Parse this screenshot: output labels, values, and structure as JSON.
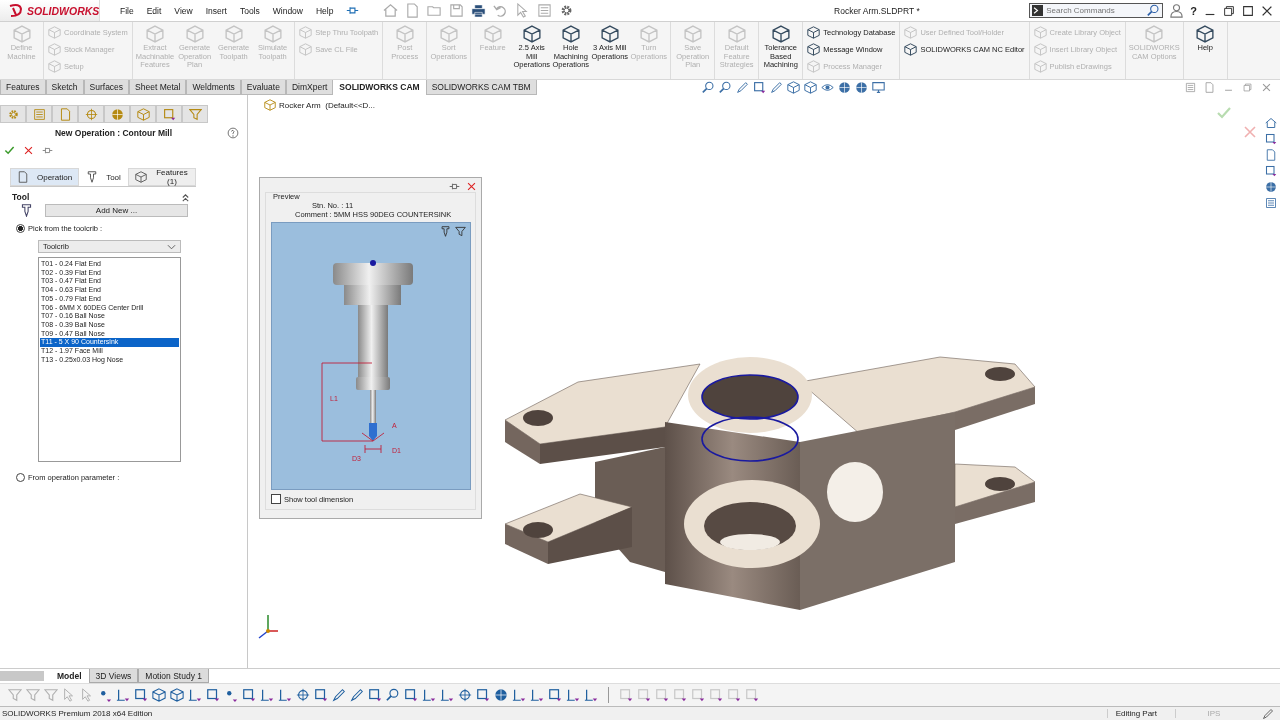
{
  "window": {
    "title": "Rocker Arm.SLDPRT *"
  },
  "logo": {
    "text": "SOLIDWORKS"
  },
  "menu": [
    "File",
    "Edit",
    "View",
    "Insert",
    "Tools",
    "Window",
    "Help"
  ],
  "search": {
    "placeholder": "Search Commands"
  },
  "help": {
    "glyph": "?"
  },
  "ribbon": [
    {
      "kind": "large",
      "items": [
        {
          "label": "Define Machine",
          "disabled": true
        }
      ]
    },
    {
      "kind": "stack",
      "items": [
        {
          "label": "Coordinate System",
          "disabled": true
        },
        {
          "label": "Stock Manager",
          "disabled": true
        },
        {
          "label": "Setup",
          "disabled": true
        }
      ]
    },
    {
      "kind": "large",
      "items": [
        {
          "label": "Extract Machinable Features",
          "disabled": true
        },
        {
          "label": "Generate Operation Plan",
          "disabled": true
        },
        {
          "label": "Generate Toolpath",
          "disabled": true
        },
        {
          "label": "Simulate Toolpath",
          "disabled": true
        }
      ]
    },
    {
      "kind": "stack",
      "items": [
        {
          "label": "Step Thru Toolpath",
          "disabled": true
        },
        {
          "label": "Save CL File",
          "disabled": true
        }
      ]
    },
    {
      "kind": "large",
      "items": [
        {
          "label": "Post Process",
          "disabled": true
        }
      ]
    },
    {
      "kind": "large",
      "items": [
        {
          "label": "Sort Operations",
          "disabled": true
        }
      ]
    },
    {
      "kind": "large",
      "items": [
        {
          "label": "Feature",
          "disabled": true
        },
        {
          "label": "2.5 Axis Mill Operations",
          "disabled": false
        },
        {
          "label": "Hole Machining Operations",
          "disabled": false
        },
        {
          "label": "3 Axis Mill Operations",
          "disabled": false
        },
        {
          "label": "Turn Operations",
          "disabled": true
        }
      ]
    },
    {
      "kind": "large",
      "items": [
        {
          "label": "Save Operation Plan",
          "disabled": true
        }
      ]
    },
    {
      "kind": "large",
      "items": [
        {
          "label": "Default Feature Strategies",
          "disabled": true
        }
      ]
    },
    {
      "kind": "large",
      "items": [
        {
          "label": "Tolerance Based Machining",
          "disabled": false
        }
      ]
    },
    {
      "kind": "stack",
      "items": [
        {
          "label": "Technology Database",
          "disabled": false
        },
        {
          "label": "Message Window",
          "disabled": false
        },
        {
          "label": "Process Manager",
          "disabled": true
        }
      ]
    },
    {
      "kind": "stack",
      "items": [
        {
          "label": "User Defined Tool/Holder",
          "disabled": true
        },
        {
          "label": "SOLIDWORKS CAM NC Editor",
          "disabled": false
        }
      ]
    },
    {
      "kind": "stack",
      "items": [
        {
          "label": "Create Library Object",
          "disabled": true
        },
        {
          "label": "Insert Library Object",
          "disabled": true
        },
        {
          "label": "Publish eDrawings",
          "disabled": true
        }
      ]
    },
    {
      "kind": "large",
      "items": [
        {
          "label": "SOLIDWORKS CAM Options",
          "disabled": true
        }
      ]
    },
    {
      "kind": "large",
      "items": [
        {
          "label": "Help",
          "disabled": false
        }
      ]
    }
  ],
  "command_tabs": [
    {
      "label": "Features",
      "selected": false
    },
    {
      "label": "Sketch",
      "selected": false
    },
    {
      "label": "Surfaces",
      "selected": false
    },
    {
      "label": "Sheet Metal",
      "selected": false
    },
    {
      "label": "Weldments",
      "selected": false
    },
    {
      "label": "Evaluate",
      "selected": false
    },
    {
      "label": "DimXpert",
      "selected": false
    },
    {
      "label": "SOLIDWORKS CAM",
      "selected": true
    },
    {
      "label": "SOLIDWORKS CAM TBM",
      "selected": false
    }
  ],
  "property_manager": {
    "title": "New Operation : Contour Mill",
    "tabs": [
      {
        "label": "Operation",
        "selected": false
      },
      {
        "label": "Tool",
        "selected": true
      },
      {
        "label": "Features (1)",
        "selected": false
      }
    ],
    "section": {
      "title": "Tool",
      "add_button": "Add New ...",
      "source_options": [
        {
          "label": "Pick from the toolcrib :",
          "selected": true
        },
        {
          "label": "From operation parameter :",
          "selected": false
        }
      ],
      "dropdown": {
        "value": "Toolcrib"
      },
      "tools": [
        {
          "label": "T01 - 0.24 Flat End",
          "selected": false
        },
        {
          "label": "T02 - 0.39 Flat End",
          "selected": false
        },
        {
          "label": "T03 - 0.47 Flat End",
          "selected": false
        },
        {
          "label": "T04 - 0.63 Flat End",
          "selected": false
        },
        {
          "label": "T05 - 0.79 Flat End",
          "selected": false
        },
        {
          "label": "T06 - 6MM X 60DEG Center Drill",
          "selected": false
        },
        {
          "label": "T07 - 0.16 Ball Nose",
          "selected": false
        },
        {
          "label": "T08 - 0.39 Ball Nose",
          "selected": false
        },
        {
          "label": "T09 - 0.47 Ball Nose",
          "selected": false
        },
        {
          "label": "T11 - 5 X 90 Countersink",
          "selected": true
        },
        {
          "label": "T12 - 1.97 Face Mill",
          "selected": false
        },
        {
          "label": "T13 - 0.25x0.03 Hog Nose",
          "selected": false
        }
      ]
    }
  },
  "feature_tree": {
    "breadcrumb": "Rocker Arm  (Default<<D..."
  },
  "preview": {
    "title": "Preview",
    "station": "Stn. No. : 11",
    "comment": "Comment : 5MM HSS 90DEG COUNTERSINK",
    "dimension_labels": [
      "L1",
      "A",
      "D3",
      "D1"
    ],
    "show_dimensions": {
      "label": "Show tool dimension",
      "checked": false
    }
  },
  "model_tabs": [
    {
      "label": "Model",
      "selected": true
    },
    {
      "label": "3D Views",
      "selected": false
    },
    {
      "label": "Motion Study 1",
      "selected": false
    }
  ],
  "status_bar": {
    "edition": "SOLIDWORKS Premium 2018 x64 Edition",
    "mode": "Editing Part",
    "units": "IPS"
  }
}
